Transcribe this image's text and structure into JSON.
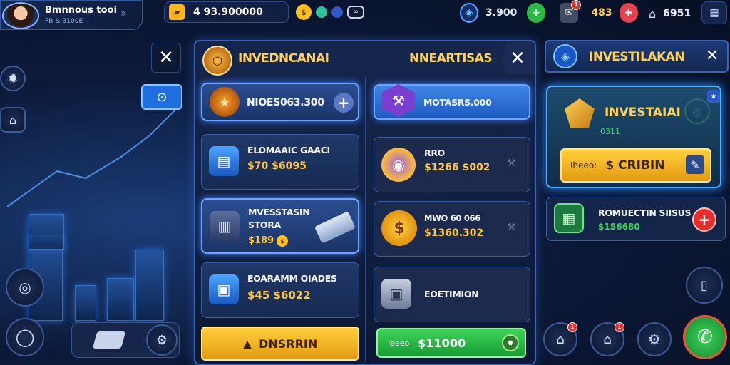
{
  "profile": {
    "name": "Bmnnous tooi",
    "subtitle": "FB & B100E"
  },
  "top_bar": {
    "gold": "4 93.900000",
    "gems": "3.900",
    "tickets": "483",
    "shield_count": "6951"
  },
  "left_panel": {
    "title": "INVEDNCANAI",
    "cards": [
      {
        "title": "NIOES063.300"
      },
      {
        "title": "ELOMAAIC GAACI",
        "price": "$70 $6095"
      },
      {
        "title": "MVESSTASIN",
        "subtitle": "STORA",
        "price": "$189"
      },
      {
        "title": "EOARAMM OIADES",
        "price": "$45 $6022"
      }
    ],
    "bottom_button": "DNSRRIN"
  },
  "mid_panel": {
    "title": "NNEARTISAS",
    "cards": [
      {
        "title": "MOTASRS.000"
      },
      {
        "title": "RRO",
        "price": "$1266 $002"
      },
      {
        "title": "MWO 60 066",
        "price": "$1360.302"
      },
      {
        "title": "EOETIMION"
      }
    ],
    "bottom_button": {
      "label": "Ieeeo",
      "value": "$11000"
    }
  },
  "right_panel": {
    "title": "INVESTILAKAN",
    "feature": {
      "title": "INVESTAIAI",
      "subtitle": "0311",
      "button_label": "Iheeo:",
      "button_value": "$ CRIBIN"
    },
    "card": {
      "title": "ROMUECTIN SIISUS",
      "price": "$1S6680"
    }
  },
  "colors": {
    "accent_gold": "#ffc640",
    "panel_border": "#3b65b3",
    "green": "#2fbd48",
    "red": "#e3302c"
  },
  "badges": {
    "shield": "1",
    "market": "1",
    "lock": "1",
    "tickets": "1"
  }
}
